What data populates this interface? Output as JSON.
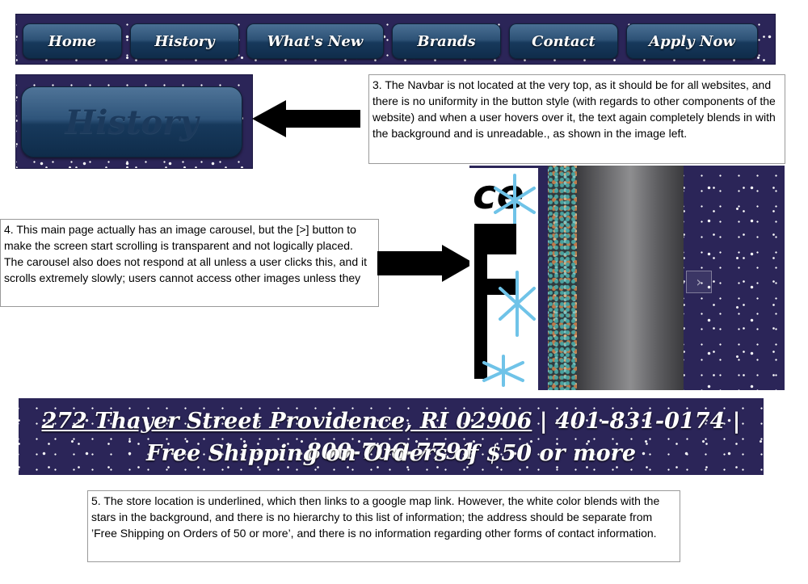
{
  "navbar": {
    "items": [
      {
        "label": "Home"
      },
      {
        "label": "History"
      },
      {
        "label": "What's New"
      },
      {
        "label": "Brands"
      },
      {
        "label": "Contact"
      },
      {
        "label": "Apply Now"
      }
    ]
  },
  "hover_example": {
    "label": "History"
  },
  "notes": {
    "navbar": "3. The Navbar is not located at the very top, as it should be for all websites, and there is no uniformity in the button style (with regards to other components of the website) and when a user hovers over it, the text again completely blends in with the background and is unreadable., as shown in the image left.",
    "carousel": "4. This main page actually has an image carousel, but the [>] button to make the screen start scrolling is transparent and not logically placed. The carousel also does not respond at all unless a user clicks this, and it scrolls extremely slowly; users cannot access other images unless they",
    "footer": "5. The store location is underlined, which then links to a google map link. However,  the white color blends with the stars in the background, and there is no hierarchy to this list of information; the address should be separate from ’Free Shipping on Orders of 50 or more’, and there is no information regarding other forms of contact information."
  },
  "carousel": {
    "ad_text_top": "ce",
    "ad_letter": "F",
    "next_glyph": "›"
  },
  "footer": {
    "address": "272 Thayer Street Providence, RI 02906",
    "separator": " | ",
    "phone1": "401-831-0174",
    "phone2": "800-706-7791",
    "shipping": "Free Shipping on Orders of $50 or more"
  },
  "colors": {
    "star_background": "#2b2558",
    "button_blue": "#2d5276",
    "annotation_arrow": "#000000"
  },
  "icons": {
    "arrow_navbar": "left-arrow-icon",
    "arrow_carousel": "right-arrow-icon",
    "snowflake": "snowflake-icon"
  }
}
